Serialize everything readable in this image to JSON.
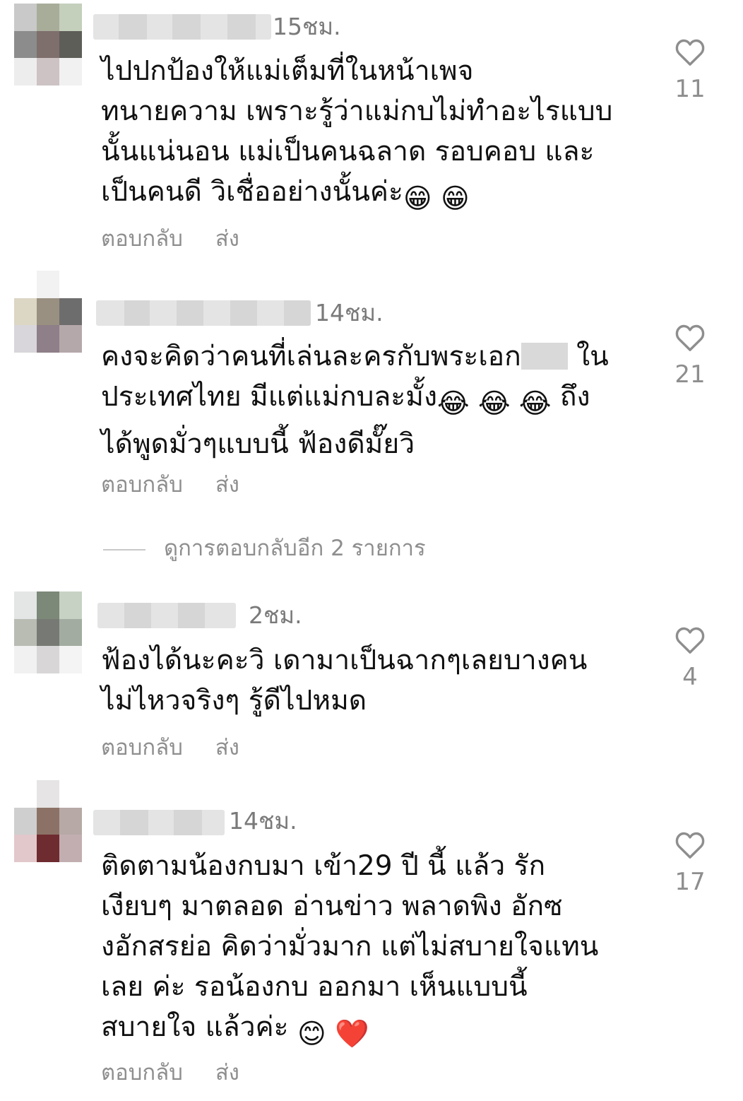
{
  "comments": [
    {
      "time": "15ชม.",
      "text": "ไปปกป้องให้แม่เต็มที่ในหน้าเพจ\nทนายความ เพราะรู้ว่าแม่กบไม่ทำอะไรแบบ\nนั้นแน่นอน แม่เป็นคนฉลาด รอบคอบ และ\nเป็นคนดี วิเชื่ออย่างนั้นค่ะ",
      "emoji": "😁 😁",
      "reply_label": "ตอบกลับ",
      "send_label": "ส่ง",
      "likes": "11"
    },
    {
      "time": "14ชม.",
      "text_a": "คงจะคิดว่าคนที่เล่นละครกับพระเอก",
      "text_b": " ใน\nประเทศไทย มีแต่แม่กบละมั้ง",
      "emoji": "😂 😂 😂",
      "text_c": " ถึง\nได้พูดมั่วๆแบบนี้ ฟ้องดีมั๊ยวิ",
      "reply_label": "ตอบกลับ",
      "send_label": "ส่ง",
      "likes": "21"
    },
    {
      "time": "2ชม.",
      "text": "ฟ้องได้นะคะวิ เดามาเป็นฉากๆเลยบางคน\nไม่ไหวจริงๆ รู้ดีไปหมด",
      "reply_label": "ตอบกลับ",
      "send_label": "ส่ง",
      "likes": "4"
    },
    {
      "time": "14ชม.",
      "text": "ติดตามน้องกบมา เข้า29 ปี นี้ แล้ว รัก\nเงียบๆ มาตลอด อ่านข่าว พลาดพิง อักซ\nงอักสรย่อ คิดว่ามั่วมาก แต่ไม่สบายใจแทน\nเลย ค่ะ  รอน้องกบ ออกมา เห็นแบบนี้\nสบายใจ แล้วค่ะ",
      "emoji": "😊 ❤️",
      "reply_label": "ตอบกลับ",
      "send_label": "ส่ง",
      "likes": "17"
    }
  ],
  "view_replies": "ดูการตอบกลับอีก 2 รายการ",
  "icons": {
    "like": "heart-outline-icon"
  }
}
